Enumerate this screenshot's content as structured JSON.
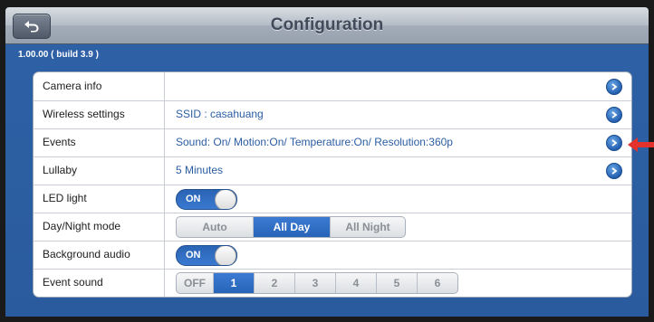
{
  "header": {
    "title": "Configuration",
    "back_icon": "back-arrow-icon"
  },
  "version": "1.00.00 ( build 3.9 )",
  "rows": [
    {
      "label": "Camera info",
      "value": ""
    },
    {
      "label": "Wireless settings",
      "value": "SSID : casahuang"
    },
    {
      "label": "Events",
      "value": "Sound: On/ Motion:On/ Temperature:On/ Resolution:360p"
    },
    {
      "label": "Lullaby",
      "value": "5 Minutes"
    },
    {
      "label": "LED light",
      "toggle": "ON"
    },
    {
      "label": "Day/Night mode",
      "options": [
        "Auto",
        "All Day",
        "All Night"
      ],
      "selected": "All Day"
    },
    {
      "label": "Background audio",
      "toggle": "ON"
    },
    {
      "label": "Event sound",
      "options": [
        "OFF",
        "1",
        "2",
        "3",
        "4",
        "5",
        "6"
      ],
      "selected": "1"
    }
  ],
  "colors": {
    "accent": "#2764b8",
    "background": "#2d60a5",
    "annotation_arrow": "#e3322b"
  }
}
